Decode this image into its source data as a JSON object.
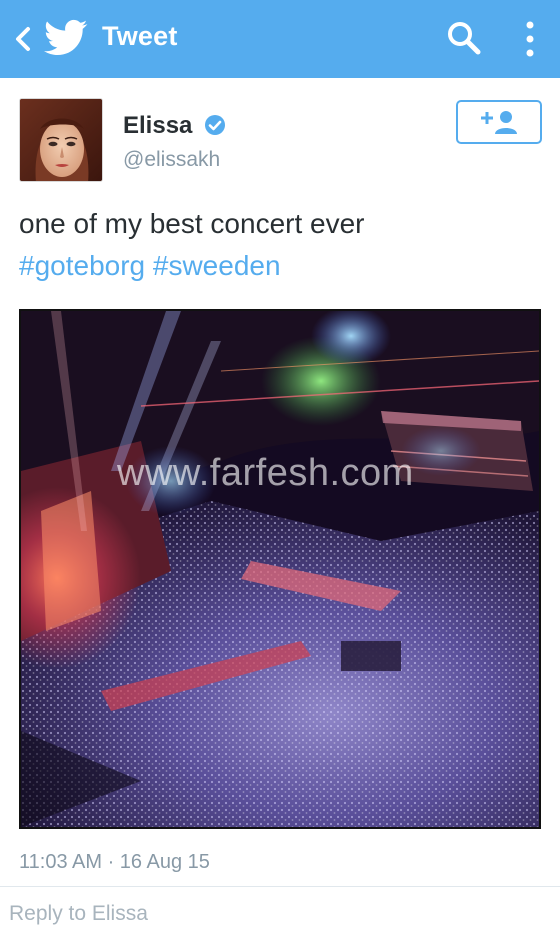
{
  "appbar": {
    "title": "Tweet",
    "icons": [
      "chevron-left-icon",
      "twitter-bird-icon",
      "search-icon",
      "more-vertical-icon"
    ],
    "color": "#55acee"
  },
  "tweet": {
    "author": {
      "name": "Elissa",
      "handle": "@elissakh",
      "verified": true
    },
    "text": "one of my best concert ever",
    "hashtags": [
      "#goteborg",
      "#sweeden"
    ],
    "media": {
      "watermark": "www.farfesh.com"
    },
    "timestamp": "11:03 AM · 16 Aug 15"
  },
  "follow_button": {
    "icon": "follow-user-icon"
  },
  "reply": {
    "placeholder": "Reply to Elissa"
  },
  "colors": {
    "accent": "#55acee",
    "text": "#292f33",
    "muted": "#8899a6"
  }
}
